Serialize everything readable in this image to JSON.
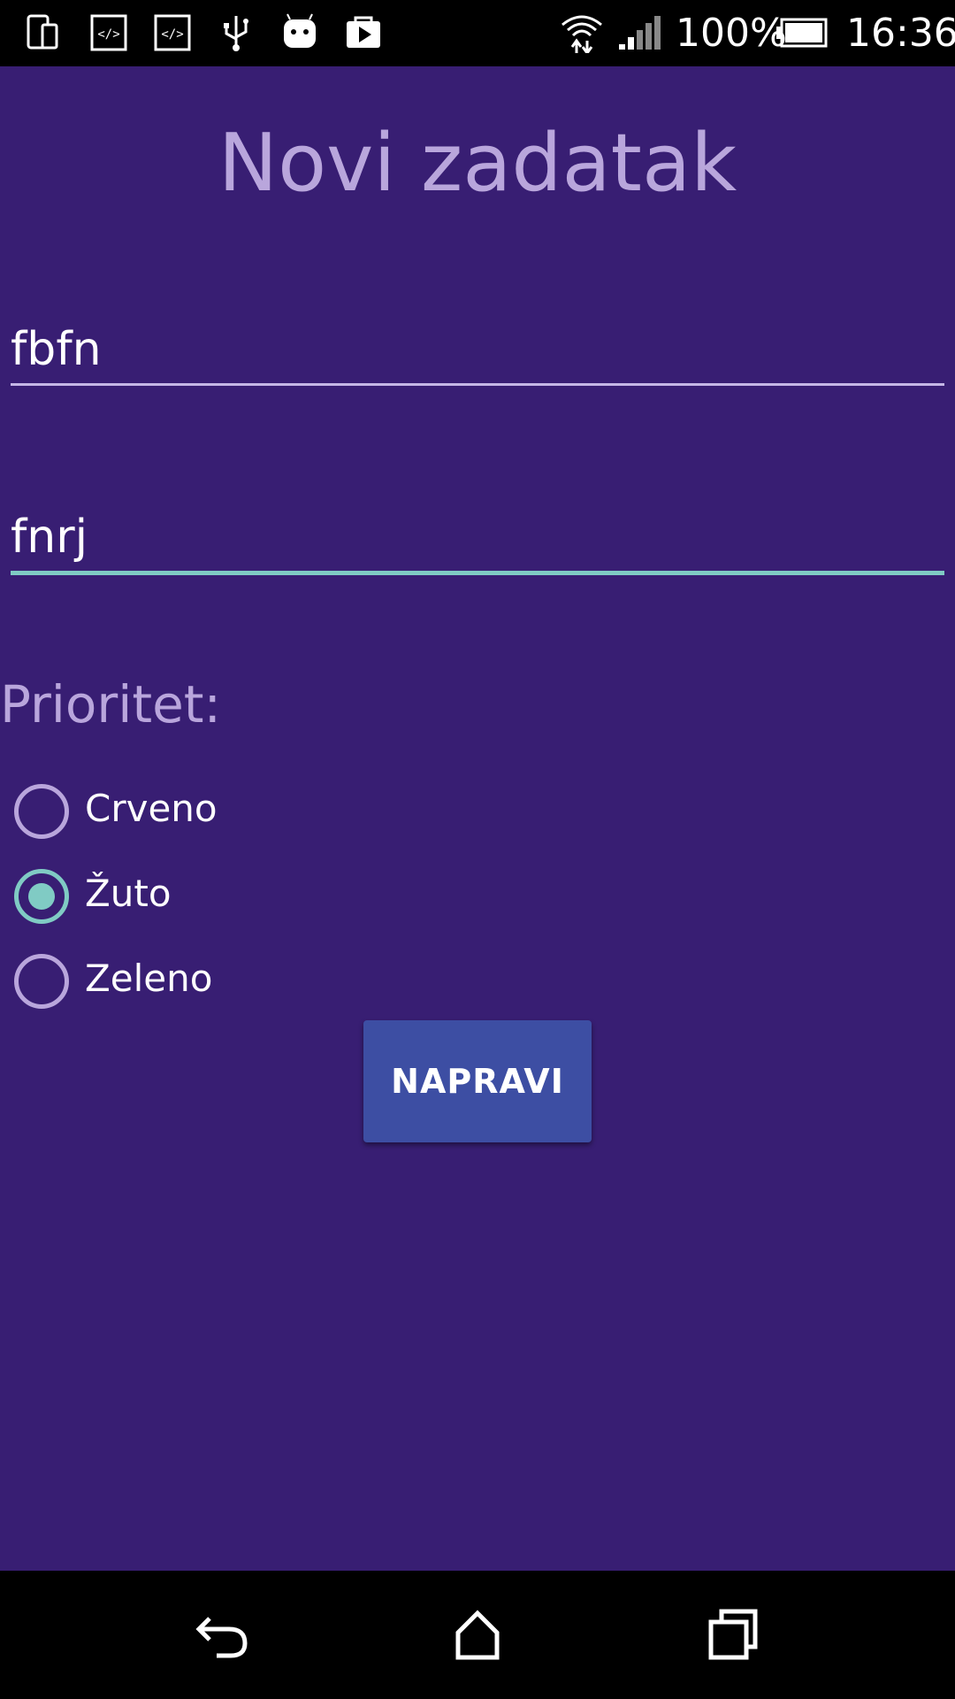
{
  "status_bar": {
    "battery_percent": "100%",
    "time": "16:36",
    "icons_left": [
      "phone-icon",
      "code-icon",
      "code-icon",
      "usb-icon",
      "android-icon",
      "play-store-icon"
    ],
    "icons_right": [
      "wifi-icon",
      "signal-icon",
      "battery-icon"
    ]
  },
  "screen": {
    "title": "Novi zadatak",
    "fields": {
      "name_value": "fbfn",
      "description_value": "fnrj"
    },
    "priority": {
      "label": "Prioritet:",
      "options": [
        {
          "label": "Crveno",
          "checked": false
        },
        {
          "label": "Žuto",
          "checked": true
        },
        {
          "label": "Zeleno",
          "checked": false
        }
      ]
    },
    "create_button_label": "NAPRAVI"
  },
  "nav_bar": {
    "icons": [
      "back-icon",
      "home-icon",
      "recents-icon"
    ]
  },
  "colors": {
    "background": "#381e73",
    "title_text": "#b9a6dc",
    "accent": "#80cbc4",
    "button": "#3d4ea3"
  }
}
